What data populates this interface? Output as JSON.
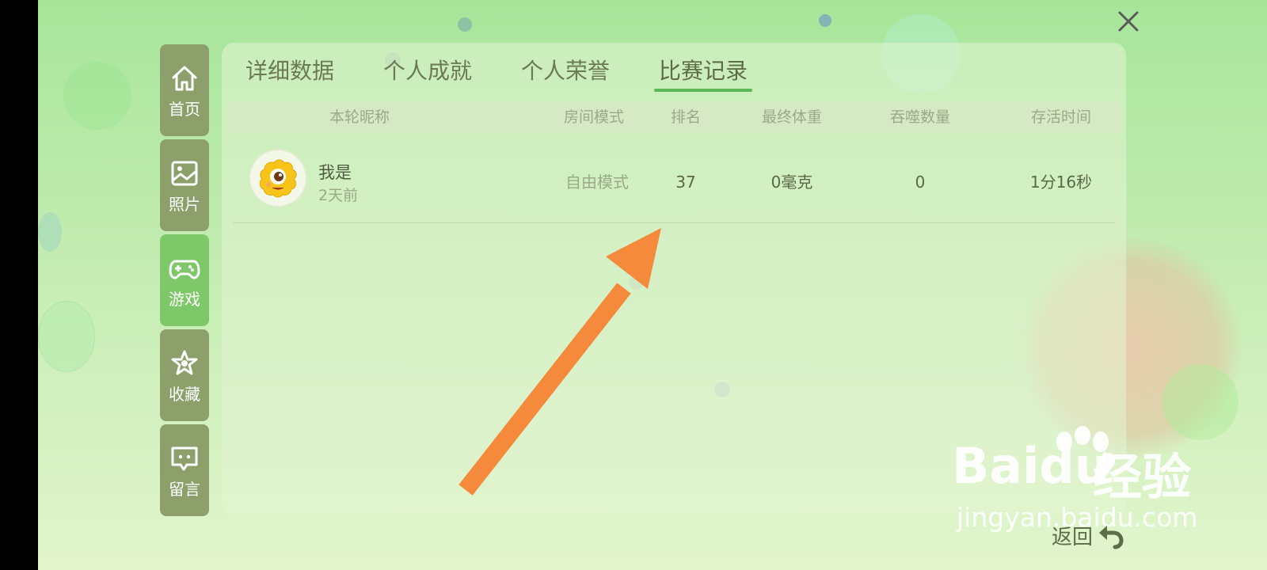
{
  "sidebar": {
    "items": [
      {
        "label": "首页",
        "icon": "home-icon",
        "active": false
      },
      {
        "label": "照片",
        "icon": "photo-icon",
        "active": false
      },
      {
        "label": "游戏",
        "icon": "gamepad-icon",
        "active": true
      },
      {
        "label": "收藏",
        "icon": "star-icon",
        "active": false
      },
      {
        "label": "留言",
        "icon": "message-icon",
        "active": false
      }
    ]
  },
  "tabs": [
    {
      "label": "详细数据",
      "active": false
    },
    {
      "label": "个人成就",
      "active": false
    },
    {
      "label": "个人荣誉",
      "active": false
    },
    {
      "label": "比赛记录",
      "active": true
    }
  ],
  "table": {
    "headers": [
      "本轮昵称",
      "房间模式",
      "排名",
      "最终体重",
      "吞噬数量",
      "存活时间"
    ],
    "rows": [
      {
        "nickname": "我是",
        "time_ago": "2天前",
        "mode": "自由模式",
        "rank": "37",
        "weight": "0毫克",
        "eaten": "0",
        "survival": "1分16秒"
      }
    ]
  },
  "back": {
    "label": "返回"
  },
  "watermark": {
    "brand": "Baidu",
    "suffix": "经验",
    "url": "jingyan.baidu.com"
  },
  "colors": {
    "accent": "#5cb85a",
    "arrow": "#f58a3c",
    "sidebar": "#8da06c",
    "sidebar_active": "#7ec86a"
  }
}
